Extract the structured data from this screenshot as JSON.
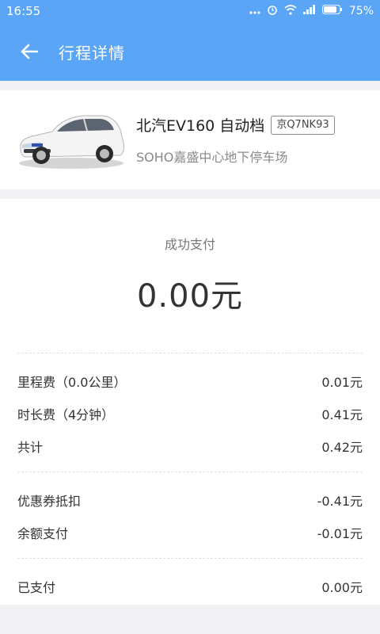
{
  "status_bar": {
    "time": "16:55",
    "battery": "75%"
  },
  "header": {
    "title": "行程详情"
  },
  "car": {
    "name": "北汽EV160 自动档",
    "plate": "京Q7NK93",
    "location": "SOHO嘉盛中心地下停车场"
  },
  "payment": {
    "status": "成功支付",
    "amount": "0.00元",
    "fees": [
      {
        "label": "里程费（0.0公里）",
        "value": "0.01元"
      },
      {
        "label": "时长费（4分钟）",
        "value": "0.41元"
      },
      {
        "label": "共计",
        "value": "0.42元"
      }
    ],
    "deductions": [
      {
        "label": "优惠券抵扣",
        "value": "-0.41元"
      },
      {
        "label": "余额支付",
        "value": "-0.01元"
      }
    ],
    "paid": {
      "label": "已支付",
      "value": "0.00元"
    }
  },
  "colors": {
    "primary": "#5aa5f5",
    "background": "#f2f2f5"
  }
}
